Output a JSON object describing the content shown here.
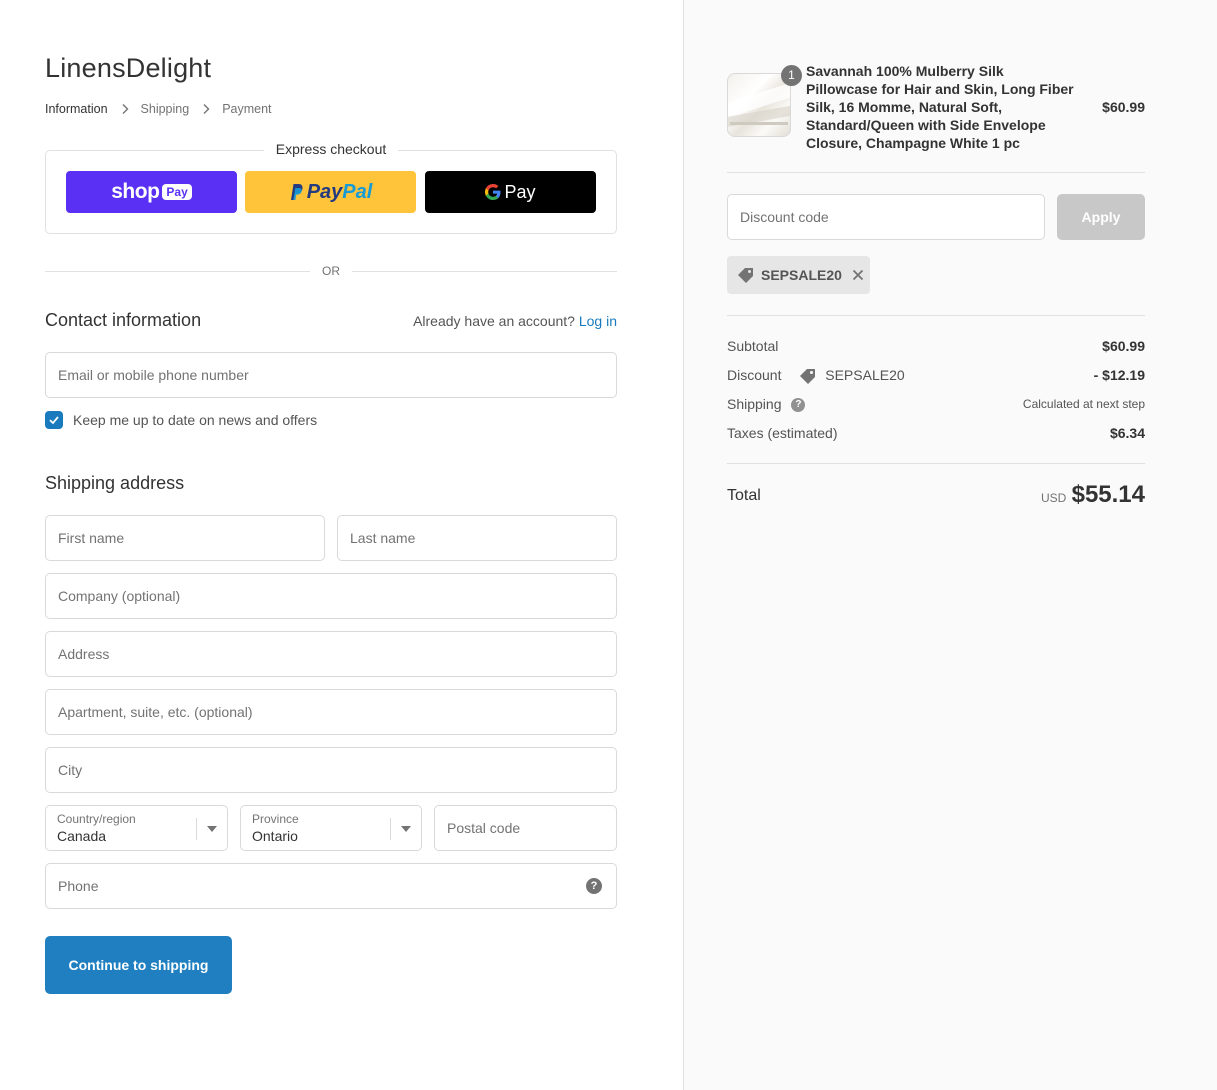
{
  "store": {
    "name": "LinensDelight"
  },
  "breadcrumb": {
    "current": "Information",
    "step2": "Shipping",
    "step3": "Payment"
  },
  "express": {
    "title": "Express checkout",
    "shop_label": "shop",
    "shop_pay_badge": "Pay",
    "paypal_p1": "Pay",
    "paypal_p2": "Pal",
    "gpay_label": "Pay"
  },
  "divider": {
    "or": "OR"
  },
  "contact": {
    "title": "Contact information",
    "account_prompt": "Already have an account?",
    "login": "Log in",
    "email_placeholder": "Email or mobile phone number",
    "newsletter_label": "Keep me up to date on news and offers",
    "newsletter_checked": true
  },
  "shipping": {
    "title": "Shipping address",
    "first_name": "First name",
    "last_name": "Last name",
    "company": "Company (optional)",
    "address": "Address",
    "apartment": "Apartment, suite, etc. (optional)",
    "city": "City",
    "country_label": "Country/region",
    "country_value": "Canada",
    "province_label": "Province",
    "province_value": "Ontario",
    "postal": "Postal code",
    "phone": "Phone",
    "help_glyph": "?"
  },
  "actions": {
    "continue": "Continue to shipping"
  },
  "summary": {
    "item": {
      "quantity": "1",
      "name": "Savannah 100% Mulberry Silk Pillowcase for Hair and Skin, Long Fiber Silk, 16 Momme, Natural Soft, Standard/Queen with Side Envelope Closure, Champagne White 1 pc",
      "price": "$60.99"
    },
    "discount_placeholder": "Discount code",
    "apply": "Apply",
    "applied_code": "SEPSALE20",
    "subtotal_label": "Subtotal",
    "subtotal": "$60.99",
    "discount_label": "Discount",
    "discount_code": "SEPSALE20",
    "discount_amount": "- $12.19",
    "shipping_label": "Shipping",
    "shipping_value": "Calculated at next step",
    "shipping_help": "?",
    "taxes_label": "Taxes (estimated)",
    "taxes": "$6.34",
    "total_label": "Total",
    "currency": "USD",
    "total": "$55.14"
  },
  "colors": {
    "accent": "#197bbd",
    "shop_pay": "#5a31f4",
    "paypal": "#ffc439",
    "gpay": "#000000"
  }
}
